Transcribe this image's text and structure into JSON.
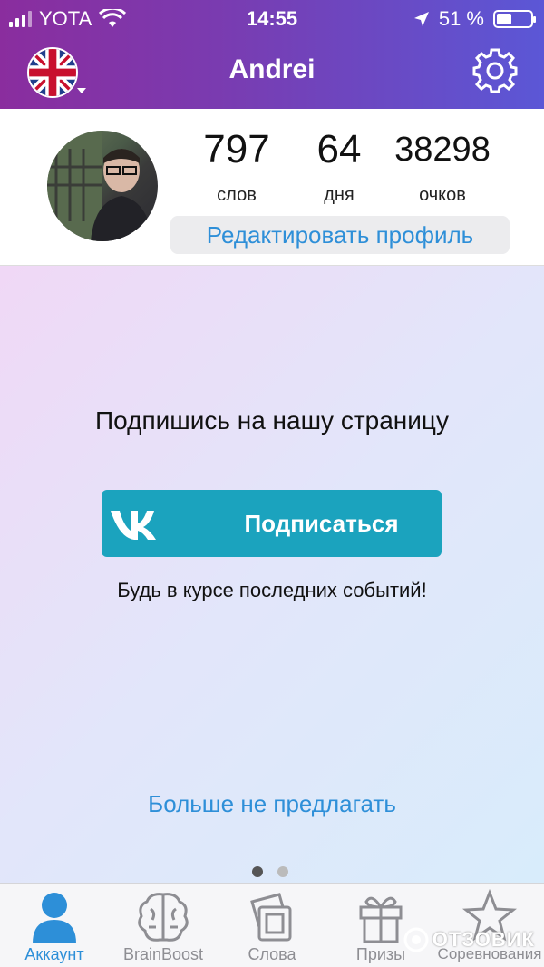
{
  "status_bar": {
    "carrier": "YOTA",
    "time": "14:55",
    "battery": "51 %",
    "battery_level": 0.51
  },
  "header": {
    "title": "Andrei",
    "language_icon": "uk-flag-icon",
    "settings_icon": "gear-icon"
  },
  "profile": {
    "stats": [
      {
        "value": "797",
        "label": "слов"
      },
      {
        "value": "64",
        "label": "дня"
      },
      {
        "value": "38298",
        "label": "очков"
      }
    ],
    "edit_button": "Редактировать профиль"
  },
  "promo": {
    "heading": "Подпишись на нашу страницу",
    "subscribe_button": "Подписаться",
    "subtext": "Будь в курсе последних событий!",
    "dismiss_link": "Больше не предлагать",
    "page_index": 1,
    "page_count": 2
  },
  "tabbar": {
    "items": [
      {
        "label": "Аккаунт",
        "icon": "person-icon",
        "active": true
      },
      {
        "label": "BrainBoost",
        "icon": "brain-icon",
        "active": false
      },
      {
        "label": "Слова",
        "icon": "cards-icon",
        "active": false
      },
      {
        "label": "Призы",
        "icon": "gift-icon",
        "active": false
      },
      {
        "label": "Соревнования",
        "icon": "star-icon",
        "active": false
      }
    ]
  },
  "watermark": "ОТЗОВИК",
  "colors": {
    "accent": "#2e8fd8",
    "vk": "#1ba3be",
    "header_start": "#8a2d9e",
    "header_end": "#5b57d6"
  }
}
